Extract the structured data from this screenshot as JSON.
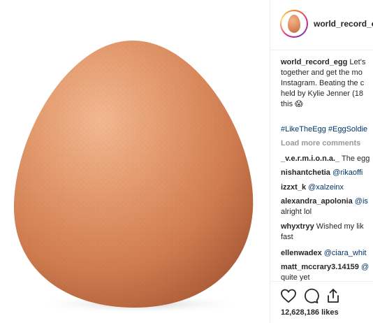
{
  "post": {
    "username": "world_record_e",
    "caption_user": "world_record_egg",
    "caption_lines": [
      "Let's",
      "together and get the mo",
      "Instagram. Beating the c",
      "held by Kylie Jenner (18",
      "this 😱"
    ],
    "hashtags": "#LikeTheEgg #EggSoldie",
    "load_more": "Load more comments",
    "comments": [
      {
        "user": "_v.e.r.m.i.o.n.a._",
        "text": "The egg",
        "line2": ""
      },
      {
        "user": "nishantchetia",
        "text": "@rikaoffi",
        "line2": ""
      },
      {
        "user": "izzxt_k",
        "text": "@xalzeinx",
        "line2": ""
      },
      {
        "user": "alexandra_apolonia",
        "text": "@is",
        "line2": "alright lol"
      },
      {
        "user": "whyxtryy",
        "text": "Wished my lik",
        "line2": "fast"
      },
      {
        "user": "ellenwadex",
        "text": "@ciara_whit",
        "line2": ""
      },
      {
        "user": "matt_mccrary3.14159",
        "text": "@",
        "line2": "quite yet"
      }
    ],
    "likes": "12,628,186 likes"
  },
  "icons": {
    "like": "heart-icon",
    "comment": "comment-icon",
    "share": "share-icon"
  },
  "colors": {
    "egg_light": "#f0b089",
    "egg_mid": "#d98758",
    "egg_dark": "#a85a35",
    "link": "#003569",
    "muted": "#999999"
  }
}
